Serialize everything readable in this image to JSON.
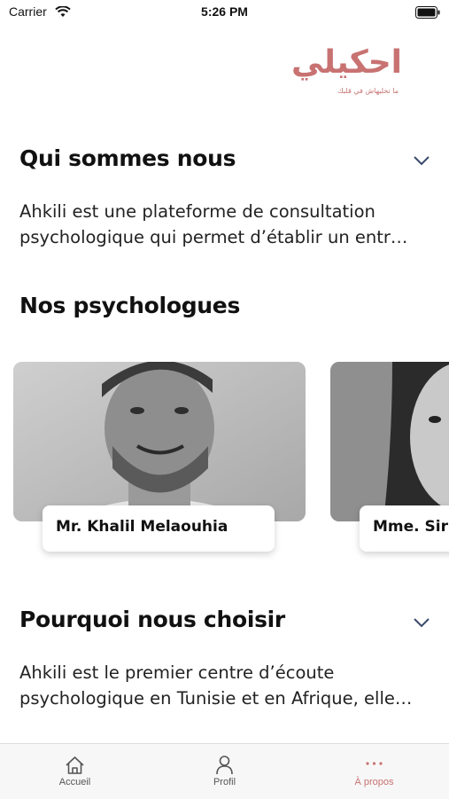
{
  "status_bar": {
    "carrier": "Carrier",
    "time": "5:26 PM"
  },
  "logo": {
    "text": "احكيلي",
    "tagline": "ما تخليهاش في قلبك",
    "color": "#c87272"
  },
  "about": {
    "title": "Qui sommes nous",
    "text": "Ahkili est une plateforme de consultation psychologique qui permet d’établir un entr…"
  },
  "psychologists": {
    "title": "Nos psychologues",
    "items": [
      {
        "name": "Mr. Khalil Melaouhia"
      },
      {
        "name": "Mme. Sirin Taieb"
      }
    ]
  },
  "why": {
    "title": "Pourquoi nous choisir",
    "text": "Ahkili est le premier centre d’écoute psychologique en Tunisie et en Afrique, elle…"
  },
  "tab_bar": {
    "tabs": [
      {
        "label": "Accueil",
        "icon": "home-icon"
      },
      {
        "label": "Profil",
        "icon": "person-icon"
      },
      {
        "label": "À propos",
        "icon": "more-dots-icon",
        "active": true
      }
    ],
    "active_color": "#c87272"
  }
}
